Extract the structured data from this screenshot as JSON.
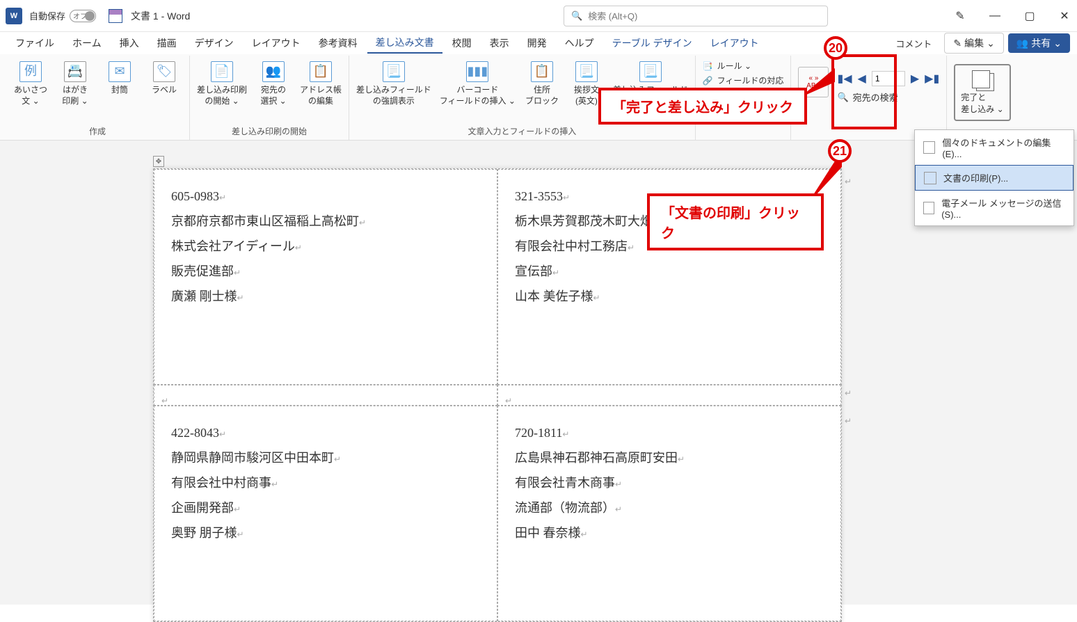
{
  "app": {
    "letter": "W",
    "autosave_label": "自動保存",
    "autosave_state": "オフ",
    "doc_title": "文書 1  -  Word",
    "search_placeholder": "検索 (Alt+Q)"
  },
  "window_controls": {
    "pen": "✎",
    "minimize": "—",
    "restore": "▢",
    "close": "✕"
  },
  "menus": {
    "file": "ファイル",
    "home": "ホーム",
    "insert": "挿入",
    "draw": "描画",
    "design": "デザイン",
    "layout": "レイアウト",
    "references": "参考資料",
    "mailings": "差し込み文書",
    "review": "校閲",
    "view": "表示",
    "developer": "開発",
    "help": "ヘルプ",
    "table_design": "テーブル デザイン",
    "table_layout": "レイアウト",
    "comments": "コメント",
    "edit": "編集",
    "share": "共有"
  },
  "ribbon": {
    "create": {
      "greeting": "あいさつ\n文 ⌄",
      "postcard": "はがき\n印刷 ⌄",
      "envelope": "封筒",
      "label": "ラベル",
      "group": "作成"
    },
    "start": {
      "start_merge": "差し込み印刷\nの開始 ⌄",
      "select_recipients": "宛先の\n選択 ⌄",
      "edit_recipients": "アドレス帳\nの編集",
      "group": "差し込み印刷の開始"
    },
    "fields": {
      "highlight_fields": "差し込みフィールド\nの強調表示",
      "barcode": "バーコード\nフィールドの挿入 ⌄",
      "address_block": "住所\nブロック",
      "greeting_line": "挨拶文\n(英文)",
      "insert_field": "差し込みフィールド\nの挿入 ⌄",
      "group": "文章入力とフィールドの挿入"
    },
    "rules": "ルール ⌄",
    "match_fields": "フィールドの対応",
    "abc": "ABC",
    "preview_small": "« »",
    "find_recipient": "宛先の検索",
    "record_value": "1",
    "finish_merge": "完了と\n差し込み ⌄",
    "finish_menu": {
      "edit_docs": "個々のドキュメントの編集(E)...",
      "print_docs": "文書の印刷(P)...",
      "send_email": "電子メール メッセージの送信(S)..."
    }
  },
  "labels": [
    {
      "left": {
        "zip": "605-0983",
        "addr": "京都府京都市東山区福稲上高松町",
        "company": "株式会社アイディール",
        "dept": "販売促進部",
        "name": "廣瀬  剛士様"
      },
      "right": {
        "zip": "321-3553",
        "addr": "栃木県芳賀郡茂木町大畑",
        "company": "有限会社中村工務店",
        "dept": "宣伝部",
        "name": "山本  美佐子様"
      }
    },
    {
      "left": {
        "zip": "422-8043",
        "addr": "静岡県静岡市駿河区中田本町",
        "company": "有限会社中村商事",
        "dept": "企画開発部",
        "name": "奥野  朋子様"
      },
      "right": {
        "zip": "720-1811",
        "addr": "広島県神石郡神石高原町安田",
        "company": "有限会社青木商事",
        "dept": "流通部（物流部）",
        "name": "田中  春奈様"
      }
    }
  ],
  "annotations": {
    "step20": "20",
    "step21": "21",
    "callout1": "「完了と差し込み」クリック",
    "callout2": "「文書の印刷」クリック"
  }
}
